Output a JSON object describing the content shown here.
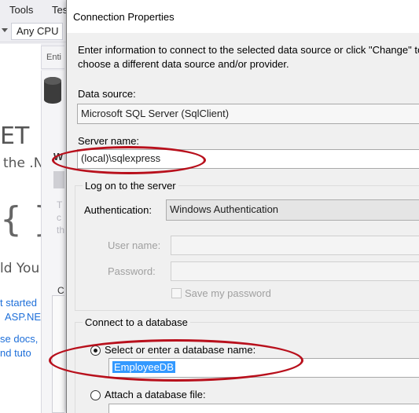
{
  "ide": {
    "menu": [
      "Tools",
      "Tes"
    ],
    "platform": "Any CPU",
    "startpage": {
      "big_et": "ET",
      "the_n": "the .N",
      "braces": "{ }",
      "build_you": "ld You",
      "get_started": "t started",
      "aspnet": "ASP.NE",
      "docs": "se docs,",
      "tutorials": "nd tuto"
    },
    "doc_tab": "Enti",
    "faint_lines": [
      "T",
      "c",
      "th"
    ],
    "lower_label": "C"
  },
  "dialog": {
    "title": "Connection Properties",
    "intro": "Enter information to connect to the selected data source or click \"Change\" to choose a different data source and/or provider.",
    "data_source_label": "Data source:",
    "data_source_value": "Microsoft SQL Server (SqlClient)",
    "server_name_label": "Server name:",
    "server_name_value": "(local)\\sqlexpress",
    "logon_group": {
      "caption": "Log on to the server",
      "auth_label": "Authentication:",
      "auth_value": "Windows Authentication",
      "user_label": "User name:",
      "user_value": "",
      "password_label": "Password:",
      "password_value": "",
      "save_password_label": "Save my password"
    },
    "connect_group": {
      "caption": "Connect to a database",
      "select_db_label": "Select or enter a database name:",
      "db_name_value": "EmployeeDB",
      "attach_label": "Attach a database file:"
    }
  },
  "colors": {
    "annotation": "#b8101c",
    "selection": "#3399ff",
    "link": "#1e6fd9"
  }
}
